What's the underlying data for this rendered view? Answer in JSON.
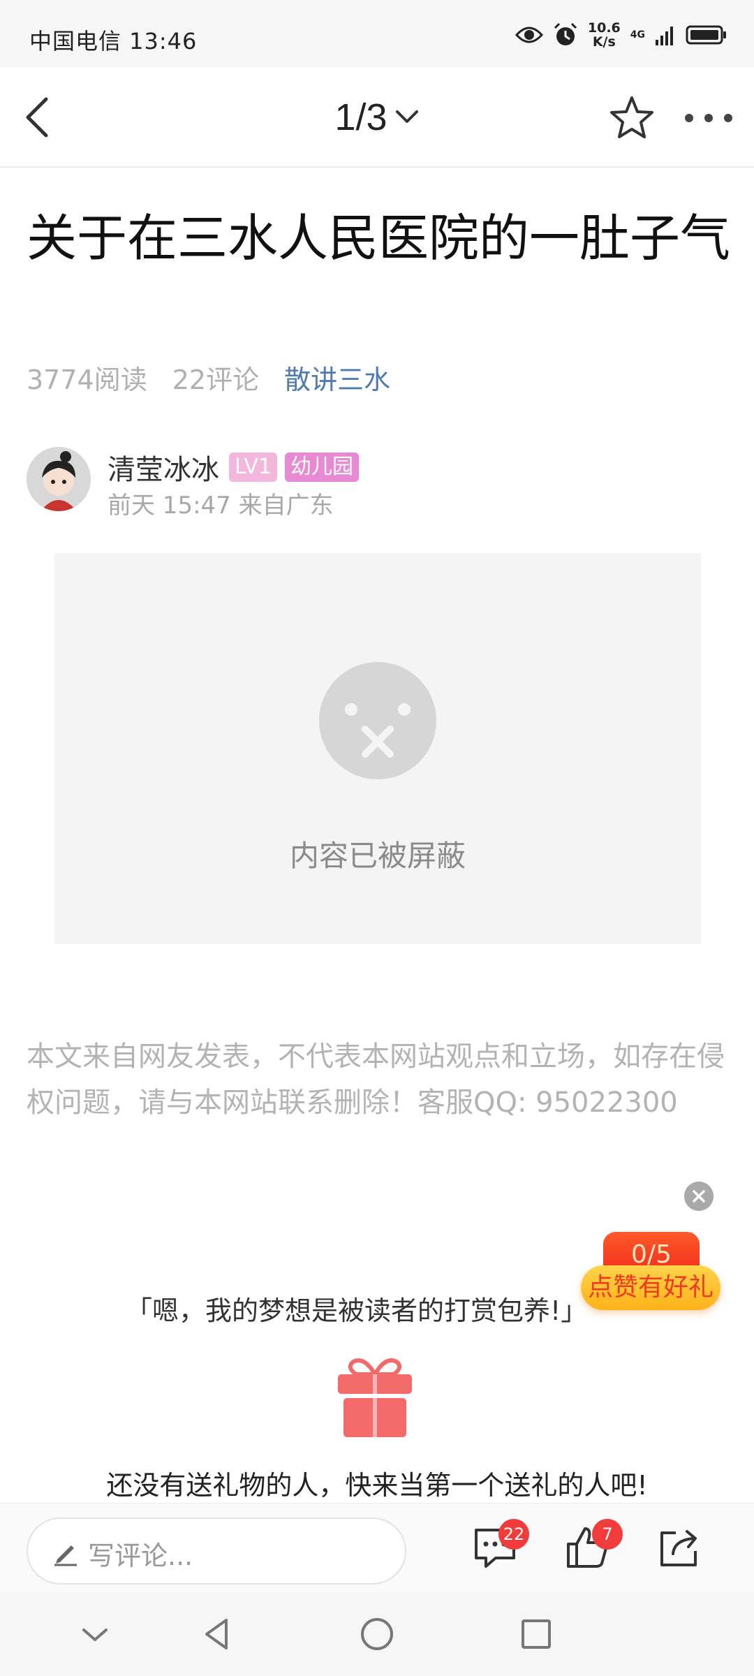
{
  "status_bar": {
    "carrier_time": "中国电信 13:46",
    "speed_value": "10.6",
    "speed_unit": "K/s",
    "network": "4G",
    "icons": [
      "eye-icon",
      "alarm-icon",
      "signal-icon",
      "battery-icon"
    ]
  },
  "nav": {
    "pager": "1/3",
    "icons": [
      "back-arrow-icon",
      "chevron-down-icon",
      "star-icon",
      "more-icon"
    ]
  },
  "article": {
    "title": "关于在三水人民医院的一肚子气",
    "reads": "3774阅读",
    "comments": "22评论",
    "category": "散讲三水",
    "category_color": "#4f7bb0",
    "author": {
      "name": "清莹冰冰",
      "level": "LV1",
      "grade": "幼儿园",
      "time_location": "前天 15:47  来自广东"
    },
    "blocked_text": "内容已被屏蔽",
    "disclaimer": "本文来自网友发表，不代表本网站观点和立场，如存在侵权问题，请与本网站联系删除！客服QQ: 95022300"
  },
  "promo": {
    "progress": "0/5",
    "label": "点赞有好礼"
  },
  "gift": {
    "quote": "「嗯，我的梦想是被读者的打赏包养!」",
    "empty_text": "还没有送礼物的人，快来当第一个送礼的人吧!",
    "accent_color": "#f36a6a"
  },
  "bottom_bar": {
    "comment_placeholder": "写评论...",
    "comment_count": "22",
    "like_count": "7",
    "icons": [
      "pencil-icon",
      "comment-icon",
      "like-icon",
      "share-icon"
    ]
  },
  "system_nav": {
    "icons": [
      "collapse-icon",
      "back-triangle-icon",
      "home-circle-icon",
      "recents-square-icon"
    ]
  }
}
